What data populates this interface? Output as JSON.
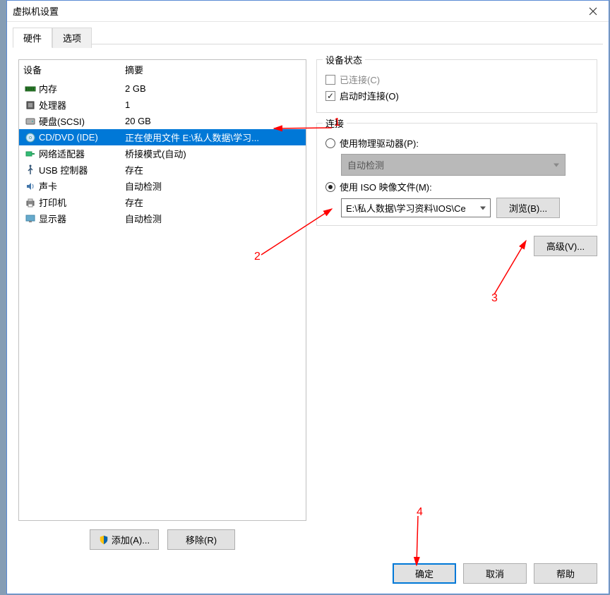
{
  "window": {
    "title": "虚拟机设置"
  },
  "tabs": {
    "hardware": "硬件",
    "options": "选项"
  },
  "list": {
    "headers": {
      "device": "设备",
      "summary": "摘要"
    },
    "rows": [
      {
        "id": "memory",
        "device": "内存",
        "summary": "2 GB"
      },
      {
        "id": "cpu",
        "device": "处理器",
        "summary": "1"
      },
      {
        "id": "hdd",
        "device": "硬盘(SCSI)",
        "summary": "20 GB"
      },
      {
        "id": "cddvd",
        "device": "CD/DVD (IDE)",
        "summary": "正在使用文件 E:\\私人数据\\学习..."
      },
      {
        "id": "nic",
        "device": "网络适配器",
        "summary": "桥接模式(自动)"
      },
      {
        "id": "usb",
        "device": "USB 控制器",
        "summary": "存在"
      },
      {
        "id": "sound",
        "device": "声卡",
        "summary": "自动检测"
      },
      {
        "id": "printer",
        "device": "打印机",
        "summary": "存在"
      },
      {
        "id": "display",
        "device": "显示器",
        "summary": "自动检测"
      }
    ],
    "buttons": {
      "add": "添加(A)...",
      "remove": "移除(R)"
    }
  },
  "state": {
    "legend": "设备状态",
    "connected": "已连接(C)",
    "connect_on_power": "启动时连接(O)"
  },
  "connection": {
    "legend": "连接",
    "use_physical": "使用物理驱动器(P):",
    "auto_detect": "自动检测",
    "use_iso": "使用 ISO 映像文件(M):",
    "iso_path": "E:\\私人数据\\学习资料\\IOS\\Ce",
    "browse": "浏览(B)..."
  },
  "advanced": "高级(V)...",
  "footer": {
    "ok": "确定",
    "cancel": "取消",
    "help": "帮助"
  },
  "annotations": {
    "n1": "1",
    "n2": "2",
    "n3": "3",
    "n4": "4"
  }
}
